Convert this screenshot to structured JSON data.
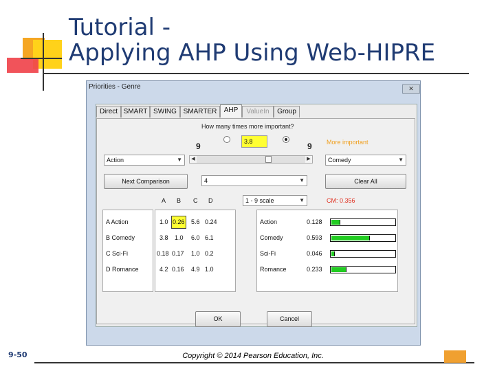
{
  "slide": {
    "title_line1": "Tutorial -",
    "title_line2": "Applying AHP Using Web-HIPRE",
    "page_number": "9-50",
    "copyright": "Copyright © 2014 Pearson Education, Inc."
  },
  "window": {
    "title": "Priorities - Genre",
    "close_glyph": "✕"
  },
  "tabs": [
    "Direct",
    "SMART",
    "SWING",
    "SMARTER",
    "AHP",
    "ValueIn",
    "Group"
  ],
  "ahp": {
    "question": "How many times more important?",
    "scale_left": "9",
    "scale_right": "9",
    "value": "3.8",
    "more_important_label": "More important",
    "left_item": "Action",
    "right_item": "Comedy",
    "next_comparison": "Next Comparison",
    "comparison_number": "4",
    "clear_all": "Clear All",
    "scale_type": "1 - 9 scale",
    "cm": "CM: 0.356",
    "slider_position": 0.66
  },
  "matrix": {
    "columns": [
      "A",
      "B",
      "C",
      "D"
    ],
    "rows": [
      {
        "label": "A Action",
        "values": [
          "1.0",
          "0.26",
          "5.6",
          "0.24"
        ]
      },
      {
        "label": "B Comedy",
        "values": [
          "3.8",
          "1.0",
          "6.0",
          "6.1"
        ]
      },
      {
        "label": "C Sci-Fi",
        "values": [
          "0.18",
          "0.17",
          "1.0",
          "0.2"
        ]
      },
      {
        "label": "D Romance",
        "values": [
          "4.2",
          "0.16",
          "4.9",
          "1.0"
        ]
      }
    ]
  },
  "priorities": [
    {
      "name": "Action",
      "value": "0.128",
      "weight": 0.128
    },
    {
      "name": "Comedy",
      "value": "0.593",
      "weight": 0.593
    },
    {
      "name": "Sci-Fi",
      "value": "0.046",
      "weight": 0.046
    },
    {
      "name": "Romance",
      "value": "0.233",
      "weight": 0.233
    }
  ],
  "buttons": {
    "ok": "OK",
    "cancel": "Cancel"
  },
  "colors": {
    "title": "#1f3b73",
    "highlight": "#ffff33",
    "bar_fill": "#22cc22",
    "more_important": "#f0a020",
    "cm": "#e03020"
  }
}
